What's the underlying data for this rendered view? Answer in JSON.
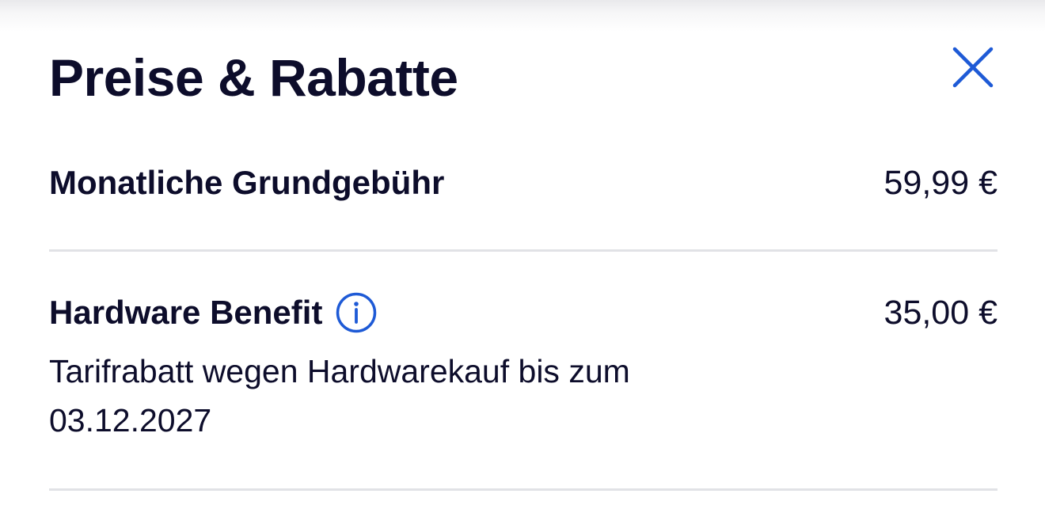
{
  "header": {
    "title": "Preise & Rabatte",
    "close_icon": "close-icon"
  },
  "items": [
    {
      "label": "Monatliche Grundgebühr",
      "price": "59,99 €"
    },
    {
      "label": "Hardware Benefit",
      "info_icon": "info-icon",
      "price": "35,00 €",
      "description": "Tarifrabatt wegen Hardwarekauf bis zum 03.12.2027"
    }
  ],
  "colors": {
    "text": "#0d0d2b",
    "accent": "#1e5ad6",
    "divider": "#e1e2e6"
  }
}
